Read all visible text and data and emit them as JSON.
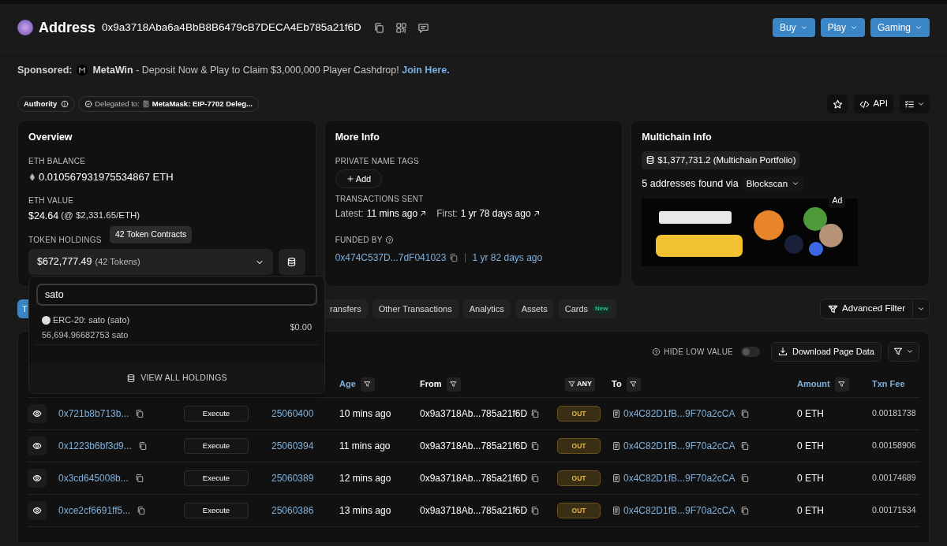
{
  "header": {
    "title": "Address",
    "address": "0x9a3718Aba6a4BbB8B6479cB7DECA4Eb785a21f6D",
    "buttons": [
      "Buy",
      "Play",
      "Gaming"
    ]
  },
  "sponsored": {
    "label": "Sponsored:",
    "brand": "MetaWin",
    "text": "- Deposit Now & Play to Claim $3,000,000 Player Cashdrop!",
    "link": "Join Here."
  },
  "tags": [
    {
      "label": "Authority"
    },
    {
      "label": "Delegated to:",
      "value": "MetaMask: EIP-7702 Deleg..."
    }
  ],
  "api_button": "API",
  "overview": {
    "title": "Overview",
    "eth_balance_label": "ETH BALANCE",
    "eth_balance": "0.010567931975534867 ETH",
    "eth_value_label": "ETH VALUE",
    "eth_value": "$24.64",
    "eth_price": "(@ $2,331.65/ETH)",
    "token_holdings_label": "TOKEN HOLDINGS",
    "token_value": "$672,777.49",
    "token_count": "(42 Tokens)",
    "tooltip": "42 Token Contracts"
  },
  "more_info": {
    "title": "More Info",
    "private_tags_label": "PRIVATE NAME TAGS",
    "add_button": "Add",
    "tx_sent_label": "TRANSACTIONS SENT",
    "latest_label": "Latest:",
    "latest": "11 mins ago",
    "first_label": "First:",
    "first": "1 yr 78 days ago",
    "funded_label": "FUNDED BY",
    "funded_address": "0x474C537D...7dF041023",
    "funded_age": "1 yr 82 days ago"
  },
  "multichain": {
    "title": "Multichain Info",
    "portfolio": "$1,377,731.2 (Multichain Portfolio)",
    "found": "5 addresses found via",
    "source": "Blockscan",
    "ad_label": "Ad"
  },
  "tabs": [
    {
      "label": "T",
      "selected": true
    },
    {
      "label": "ransfers",
      "selected": false
    },
    {
      "label": "Other Transactions",
      "selected": false
    },
    {
      "label": "Analytics",
      "selected": false
    },
    {
      "label": "Assets",
      "selected": false
    },
    {
      "label": "Cards",
      "badge": "New",
      "selected": false
    }
  ],
  "advanced_filter": "Advanced Filter",
  "table": {
    "hide_low_value": {
      "label": "HIDE LOW VALUE",
      "on": false
    },
    "download": "Download Page Data",
    "columns": [
      {
        "label": "Age",
        "kind": "header",
        "link": true,
        "filter": true
      },
      {
        "label": "From",
        "kind": "header",
        "link": false,
        "filter": true
      },
      {
        "label": "ANY",
        "kind": "filter-button"
      },
      {
        "label": "To",
        "kind": "header",
        "link": false,
        "filter": true
      },
      {
        "label": "Amount",
        "kind": "header",
        "link": true,
        "filter": true
      },
      {
        "label": "Txn Fee",
        "kind": "header",
        "link": true,
        "filter": false
      }
    ],
    "rows": [
      {
        "hash": "0x721b8b713b...",
        "method": "Execute",
        "block": "25060400",
        "age": "10 mins ago",
        "from": "0x9a3718Ab...785a21f6D",
        "direction": "OUT",
        "to": "0x4C82D1fB...9F70a2cCA",
        "amount": "0 ETH",
        "fee": "0.00181738"
      },
      {
        "hash": "0x1223b6bf3d9...",
        "method": "Execute",
        "block": "25060394",
        "age": "11 mins ago",
        "from": "0x9a3718Ab...785a21f6D",
        "direction": "OUT",
        "to": "0x4C82D1fB...9F70a2cCA",
        "amount": "0 ETH",
        "fee": "0.00158906"
      },
      {
        "hash": "0x3cd645008b...",
        "method": "Execute",
        "block": "25060389",
        "age": "12 mins ago",
        "from": "0x9a3718Ab...785a21f6D",
        "direction": "OUT",
        "to": "0x4C82D1fB...9F70a2cCA",
        "amount": "0 ETH",
        "fee": "0.00174689"
      },
      {
        "hash": "0xce2cf6691ff5...",
        "method": "Execute",
        "block": "25060386",
        "age": "13 mins ago",
        "from": "0x9a3718Ab...785a21f6D",
        "direction": "OUT",
        "to": "0x4C82D1fB...9F70a2cCA",
        "amount": "0 ETH",
        "fee": "0.00171534"
      }
    ]
  },
  "token_dropdown": {
    "search": "sato",
    "results": [
      {
        "name": "ERC-20: sato (sato)",
        "balance": "56,694.96682753 sato",
        "value": "$0.00"
      }
    ],
    "view_all": "VIEW ALL HOLDINGS"
  }
}
